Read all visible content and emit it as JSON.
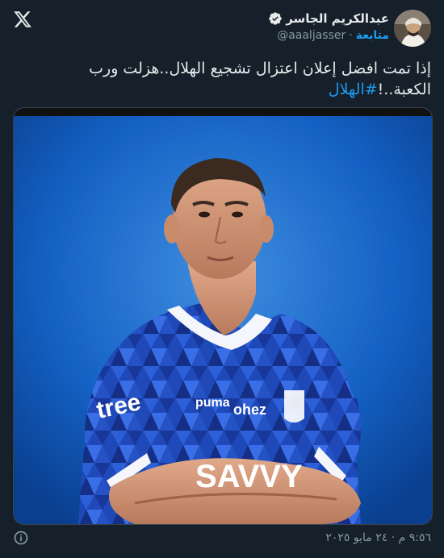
{
  "header": {
    "display_name": "عبدالكريم الجاسر",
    "handle": "@aaaljasser",
    "separator": "·",
    "follow_label": "متابعة"
  },
  "tweet": {
    "text": "إذا تمت افضل إعلان اعتزال تشجيع الهلال..هزلت ورب الكعبة..!",
    "hashtag": "#الهلال"
  },
  "media": {
    "jersey_sponsor": "tree",
    "jersey_front": "SAVVY",
    "jersey_brand": "puma",
    "jersey_partner": "ohez"
  },
  "footer": {
    "timestamp": "٩:٥٦ م · ٢٤ مايو ٢٠٢٥"
  },
  "colors": {
    "background": "#15202b",
    "accent": "#1d9bf0",
    "muted": "#8b98a5"
  },
  "icons": {
    "logo": "x-logo-icon",
    "verified": "verified-badge-icon",
    "info": "info-icon"
  }
}
